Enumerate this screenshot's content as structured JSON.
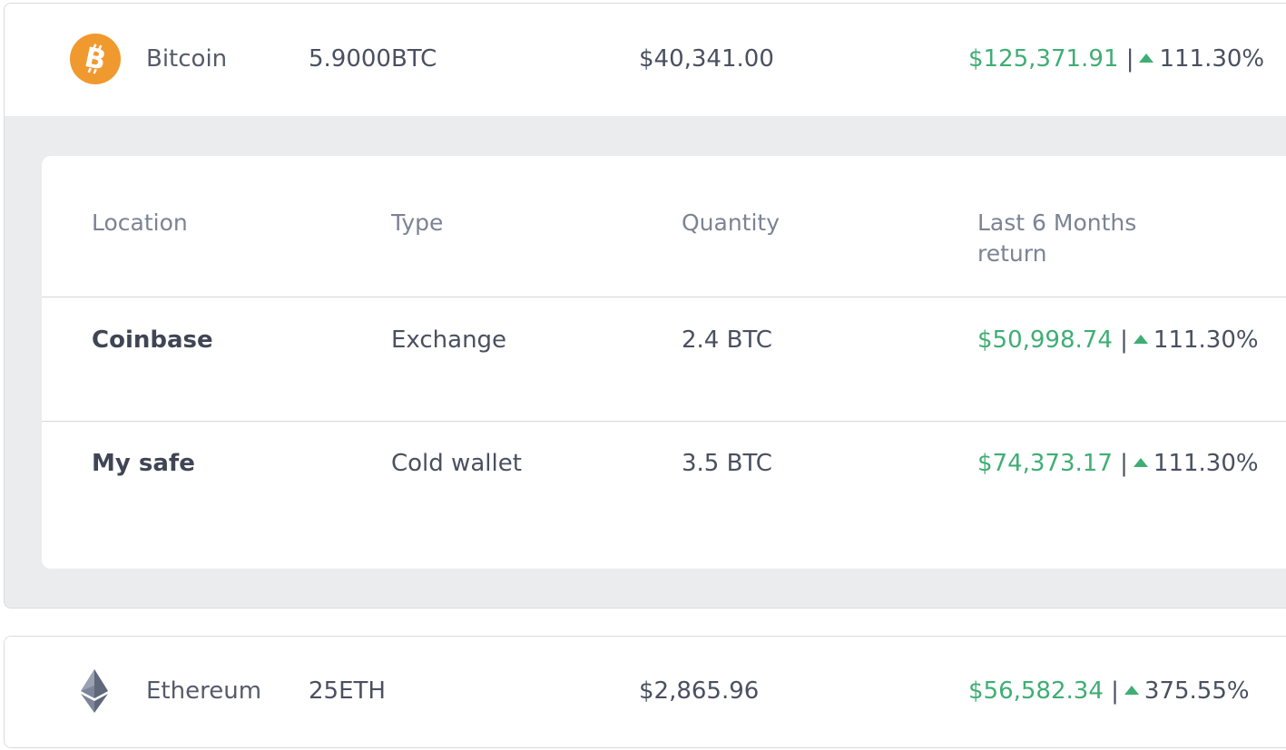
{
  "assets": [
    {
      "name": "Bitcoin",
      "icon": "bitcoin-icon",
      "icon_color": "#f0992e",
      "holdings": "5.9000BTC",
      "price": "$40,341.00",
      "return_value": "$125,371.91",
      "separator": "|",
      "return_pct": "111.30%",
      "expanded": true,
      "details": {
        "headers": {
          "location": "Location",
          "type": "Type",
          "quantity": "Quantity",
          "return_line1": "Last 6 Months",
          "return_line2": "return"
        },
        "rows": [
          {
            "location": "Coinbase",
            "type": "Exchange",
            "quantity": "2.4 BTC",
            "return_value": "$50,998.74",
            "separator": "|",
            "return_pct": "111.30%"
          },
          {
            "location": "My safe",
            "type": "Cold wallet",
            "quantity": "3.5 BTC",
            "return_value": "$74,373.17",
            "separator": "|",
            "return_pct": "111.30%"
          }
        ]
      }
    },
    {
      "name": "Ethereum",
      "icon": "ethereum-icon",
      "icon_color": "#6b7389",
      "holdings": "25ETH",
      "price": "$2,865.96",
      "return_value": "$56,582.34",
      "separator": "|",
      "return_pct": "375.55%",
      "expanded": false
    }
  ],
  "colors": {
    "positive": "#3fae74",
    "text": "#4a5060",
    "muted": "#7b8394",
    "panel_bg": "#ebecee"
  }
}
